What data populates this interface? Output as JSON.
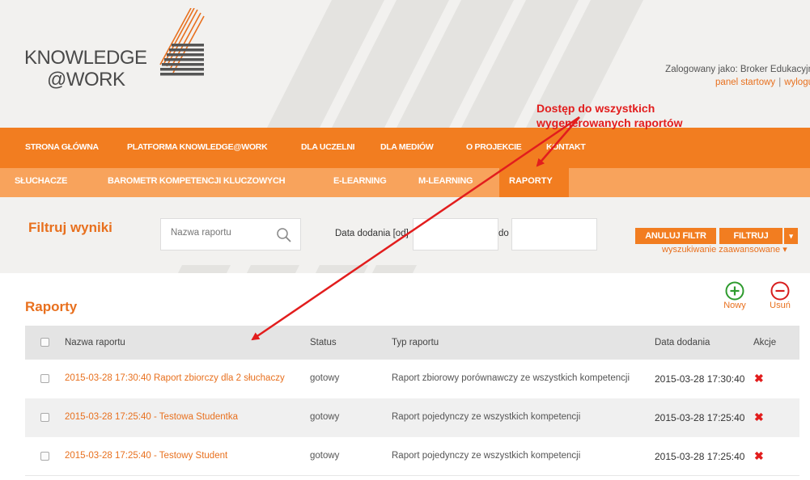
{
  "header": {
    "logo_line1": "KNOWLEDGE",
    "logo_line2": "@WORK",
    "logged_in_label": "Zalogowany jako: Broker Edukacyjn",
    "link_panel": "panel startowy",
    "link_separator": "|",
    "link_logout": "wylogu"
  },
  "nav_main": [
    "STRONA GŁÓWNA",
    "PLATFORMA KNOWLEDGE@WORK",
    "DLA UCZELNI",
    "DLA MEDIÓW",
    "O PROJEKCIE",
    "KONTAKT"
  ],
  "nav_sub": [
    "SŁUCHACZE",
    "BAROMETR KOMPETENCJI KLUCZOWYCH",
    "E-LEARNING",
    "M-LEARNING",
    "RAPORTY"
  ],
  "filter": {
    "title": "Filtruj wyniki",
    "search_placeholder": "Nazwa raportu",
    "date_from_label": "Data dodania [od]",
    "date_to_label": "do",
    "cancel_label": "ANULUJ FILTR",
    "filter_label": "FILTRUJ",
    "filter_dropdown": "▾",
    "advanced_label": "wyszukiwanie zaawansowane",
    "advanced_caret": "▾"
  },
  "reports": {
    "title": "Raporty",
    "new_label": "Nowy",
    "delete_label": "Usuń",
    "columns": [
      "Nazwa raportu",
      "Status",
      "Typ raportu",
      "Data dodania",
      "Akcje"
    ],
    "rows": [
      {
        "name": "2015-03-28 17:30:40 Raport zbiorczy dla 2 słuchaczy",
        "status": "gotowy",
        "type": "Raport zbiorowy porównawczy ze wszystkich kompetencji",
        "date": "2015-03-28 17:30:40",
        "action": "✖"
      },
      {
        "name": "2015-03-28 17:25:40 - Testowa Studentka",
        "status": "gotowy",
        "type": "Raport pojedynczy ze wszystkich kompetencji",
        "date": "2015-03-28 17:25:40",
        "action": "✖"
      },
      {
        "name": "2015-03-28 17:25:40 - Testowy Student",
        "status": "gotowy",
        "type": "Raport pojedynczy ze wszystkich kompetencji",
        "date": "2015-03-28 17:25:40",
        "action": "✖"
      }
    ]
  },
  "annotation": {
    "line1": "Dostęp do wszystkich",
    "line2": "wygenerowanych raportów"
  },
  "colors": {
    "accent": "#f27d20",
    "accent_light": "#f8a35c",
    "annotation": "#e21d1d",
    "new_icon": "#2e9b2e",
    "delete_icon": "#d81e1e"
  }
}
